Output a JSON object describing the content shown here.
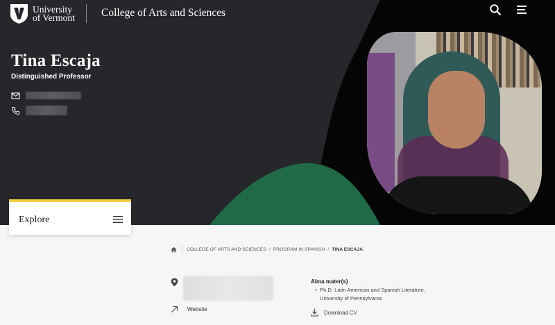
{
  "header": {
    "university_line1": "University",
    "university_line2": "of Vermont",
    "college": "College of Arts and Sciences",
    "icons": {
      "search": "search-icon",
      "menu": "hamburger-menu-icon",
      "logo": "uvm-shield-logo"
    }
  },
  "profile": {
    "name": "Tina Escaja",
    "title": "Distinguished Professor",
    "contact": [
      {
        "icon": "envelope-icon",
        "value": ""
      },
      {
        "icon": "phone-icon",
        "value": ""
      }
    ],
    "photo_alt": "Tina Escaja"
  },
  "explore": {
    "label": "Explore",
    "icon": "hamburger-menu-icon"
  },
  "breadcrumb": {
    "home_icon": "home-icon",
    "items": [
      "College of Arts and Sciences",
      "Program in Spanish"
    ],
    "separator": "/",
    "current": "Tina Escaja"
  },
  "details": {
    "location_icon": "map-pin-icon",
    "website": {
      "label": "Website",
      "icon": "arrow-up-left-icon"
    },
    "alma_mater": {
      "title": "Alma mater(s)",
      "items": [
        "Ph.D. Latin American and Spanish Literature, University of Pennsylvania"
      ]
    },
    "download_cv": {
      "label": "Download CV",
      "icon": "download-icon"
    }
  },
  "colors": {
    "hero_bg": "#25272a",
    "accent_green": "#1f6b47",
    "accent_yellow": "#f4d03f",
    "page_bg": "#f6f6f6"
  }
}
